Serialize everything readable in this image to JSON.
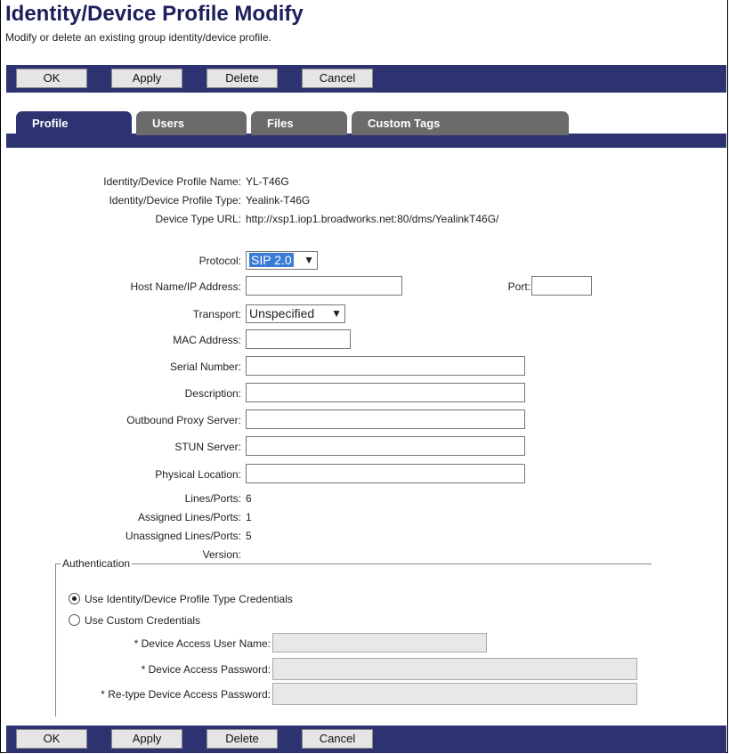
{
  "page": {
    "title": "Identity/Device Profile Modify",
    "subtitle": "Modify or delete an existing group identity/device profile."
  },
  "buttons": {
    "ok": "OK",
    "apply": "Apply",
    "delete": "Delete",
    "cancel": "Cancel"
  },
  "tabs": [
    {
      "label": "Profile",
      "active": true
    },
    {
      "label": "Users",
      "active": false
    },
    {
      "label": "Files",
      "active": false
    },
    {
      "label": "Custom Tags",
      "active": false
    }
  ],
  "info": {
    "profile_name_label": "Identity/Device Profile Name:",
    "profile_name": "YL-T46G",
    "profile_type_label": "Identity/Device Profile Type:",
    "profile_type": "Yealink-T46G",
    "device_type_url_label": "Device Type URL:",
    "device_type_url": "http://xsp1.iop1.broadworks.net:80/dms/YealinkT46G/"
  },
  "form": {
    "protocol_label": "Protocol:",
    "protocol_value": "SIP 2.0",
    "host_label": "Host Name/IP Address:",
    "host_value": "",
    "port_label": "Port:",
    "port_value": "",
    "transport_label": "Transport:",
    "transport_value": "Unspecified",
    "mac_label": "MAC Address:",
    "mac_value": "",
    "serial_label": "Serial Number:",
    "serial_value": "",
    "description_label": "Description:",
    "description_value": "",
    "outbound_proxy_label": "Outbound Proxy Server:",
    "outbound_proxy_value": "",
    "stun_label": "STUN Server:",
    "stun_value": "",
    "location_label": "Physical Location:",
    "location_value": "",
    "lines_label": "Lines/Ports:",
    "lines_value": "6",
    "assigned_label": "Assigned Lines/Ports:",
    "assigned_value": "1",
    "unassigned_label": "Unassigned Lines/Ports:",
    "unassigned_value": "5",
    "version_label": "Version:",
    "version_value": ""
  },
  "auth": {
    "legend": "Authentication",
    "option_type": "Use Identity/Device Profile Type Credentials",
    "option_custom": "Use Custom Credentials",
    "selected": "type",
    "username_label": "* Device Access User Name:",
    "password_label": "* Device Access Password:",
    "retype_label": "* Re-type Device Access Password:"
  },
  "colors": {
    "navy": "#2d3271",
    "title": "#1c1f5c",
    "tab_inactive": "#6b6b6b",
    "protocol_highlight": "#3a7bd5"
  }
}
